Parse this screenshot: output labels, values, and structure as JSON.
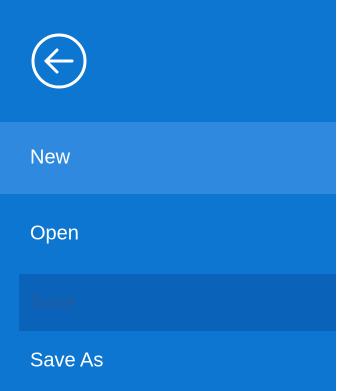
{
  "backstage": {
    "back_button": {
      "icon": "back-arrow-circle-icon",
      "label": ""
    },
    "menu": {
      "items": [
        {
          "label": "New",
          "state": "hover"
        },
        {
          "label": "Open",
          "state": "normal"
        },
        {
          "label": "Save",
          "state": "disabled"
        },
        {
          "label": "Save As",
          "state": "normal"
        }
      ]
    },
    "colors": {
      "background": "#0d76d1",
      "hover": "#2f89de",
      "disabled_bg": "#0a63b9",
      "disabled_text": "#215ea3",
      "text": "#ffffff"
    }
  }
}
